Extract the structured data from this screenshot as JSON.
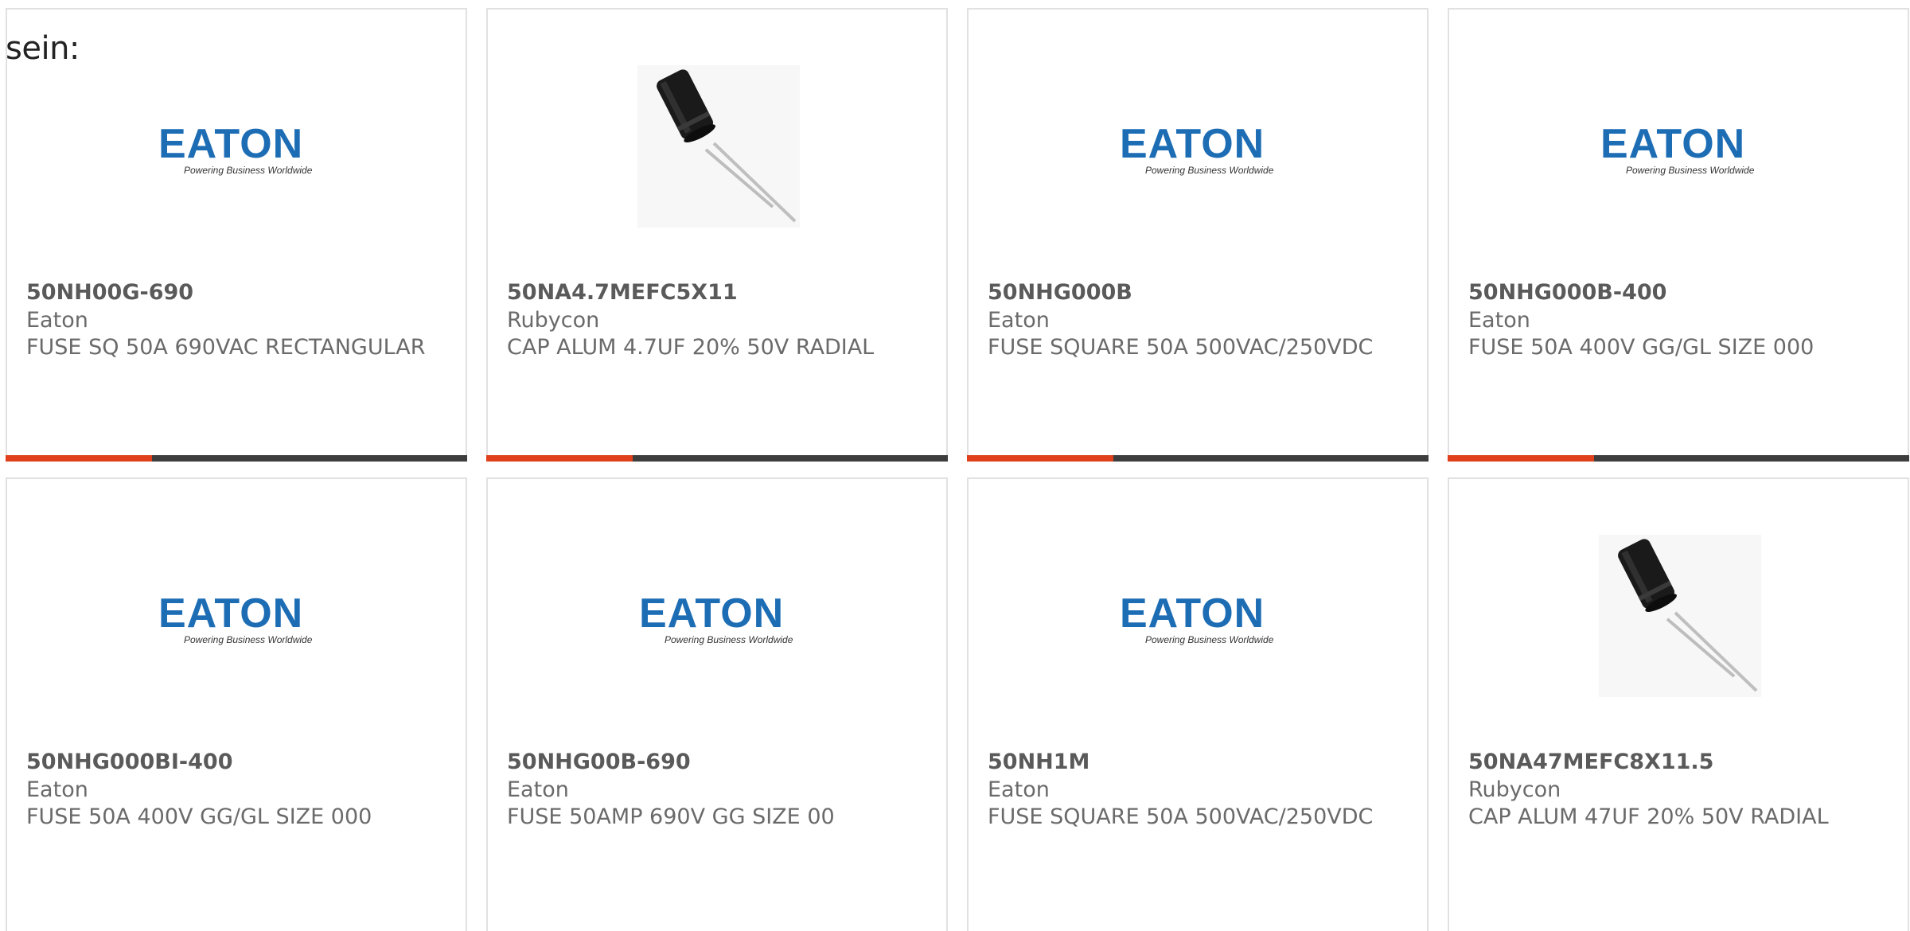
{
  "lead_text": "sein:",
  "colors": {
    "accent": "#e0401c",
    "bar_dark": "#3d3d3d",
    "eaton_blue": "#1d6db5"
  },
  "products": [
    {
      "part_number": "50NH00G-690",
      "manufacturer": "Eaton",
      "description": "FUSE SQ 50A 690VAC RECTANGULAR",
      "image": "eaton-logo",
      "logo_text": "EATON",
      "logo_tagline": "Powering Business Worldwide"
    },
    {
      "part_number": "50NA4.7MEFC5X11",
      "manufacturer": "Rubycon",
      "description": "CAP ALUM 4.7UF 20% 50V RADIAL",
      "image": "capacitor-photo"
    },
    {
      "part_number": "50NHG000B",
      "manufacturer": "Eaton",
      "description": "FUSE SQUARE 50A 500VAC/250VDC",
      "image": "eaton-logo",
      "logo_text": "EATON",
      "logo_tagline": "Powering Business Worldwide"
    },
    {
      "part_number": "50NHG000B-400",
      "manufacturer": "Eaton",
      "description": "FUSE 50A 400V GG/GL SIZE 000",
      "image": "eaton-logo",
      "logo_text": "EATON",
      "logo_tagline": "Powering Business Worldwide"
    },
    {
      "part_number": "50NHG000BI-400",
      "manufacturer": "Eaton",
      "description": "FUSE 50A 400V GG/GL SIZE 000",
      "image": "eaton-logo",
      "logo_text": "EATON",
      "logo_tagline": "Powering Business Worldwide"
    },
    {
      "part_number": "50NHG00B-690",
      "manufacturer": "Eaton",
      "description": "FUSE 50AMP 690V GG SIZE 00",
      "image": "eaton-logo",
      "logo_text": "EATON",
      "logo_tagline": "Powering Business Worldwide"
    },
    {
      "part_number": "50NH1M",
      "manufacturer": "Eaton",
      "description": "FUSE SQUARE 50A 500VAC/250VDC",
      "image": "eaton-logo",
      "logo_text": "EATON",
      "logo_tagline": "Powering Business Worldwide"
    },
    {
      "part_number": "50NA47MEFC8X11.5",
      "manufacturer": "Rubycon",
      "description": "CAP ALUM 47UF 20% 50V RADIAL",
      "image": "capacitor-photo"
    }
  ]
}
